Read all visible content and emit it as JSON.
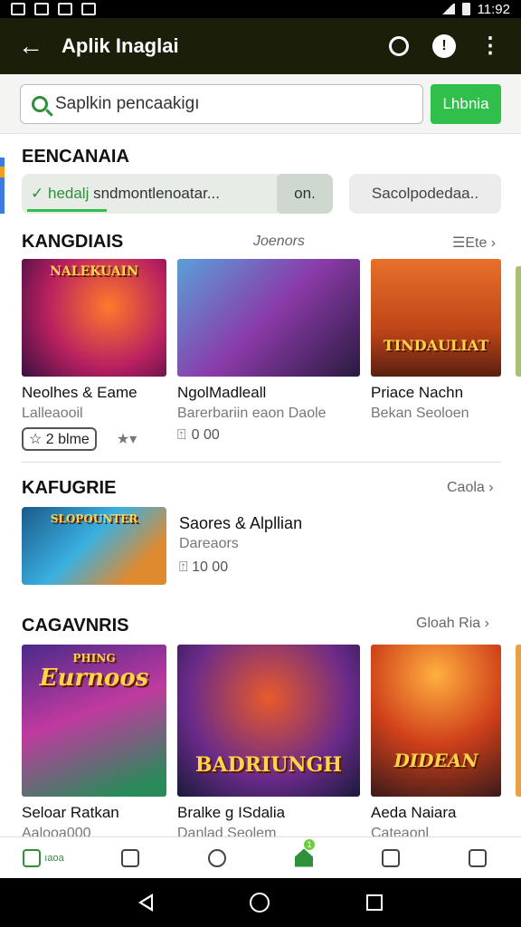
{
  "statusbar": {
    "time": "11:92"
  },
  "appbar": {
    "back_icon": "←",
    "title": "Aplik Ɩnaglai",
    "badge_glyph": "!"
  },
  "search": {
    "placeholder": "Saplkin pencaakigı",
    "button_label": "Lhbnia"
  },
  "section1": {
    "title": "EENCANAIA",
    "filter_prefix": "hedalj",
    "filter_text": "sndmontlenoatar...",
    "filter_on": "on.",
    "filter_right": "Sacolpodedaa.."
  },
  "section2": {
    "title": "KANGDIAIS",
    "middle_link": "Joenors",
    "right_link": "Ete",
    "cards": [
      {
        "name": "Neolhes & Eame",
        "sub": "Lalleaooil",
        "pill": "2  blme",
        "thumb_text": "NALEKUAIN"
      },
      {
        "name": "NgolMadleall",
        "sub": "Barerbariin eaon Daole",
        "meta": "0 00"
      },
      {
        "name": "Priace Nachn",
        "sub": "Bekan Seoloen",
        "thumb_text": "TINDAULIAT"
      }
    ]
  },
  "section3": {
    "title": "KAFUGRIE",
    "link": "Caola",
    "item": {
      "name": "Saores & Alpllian",
      "sub": "Dareaors",
      "meta": "10 00",
      "thumb_text": "SLOPOUNTER"
    }
  },
  "section4": {
    "title": "CAGAVNRIS",
    "link": "Gloah Ria",
    "cards": [
      {
        "name": "Seloar Ratkan",
        "sub": "Aalooa000",
        "thumb_text": "Eurnoos",
        "thumb_top": "PHING"
      },
      {
        "name": "Bralke g ISdalia",
        "sub": "Danlad Seolem",
        "thumb_text": "BADRIUNGH"
      },
      {
        "name": "Aeda Naiara",
        "sub": "Cateaonl",
        "thumb_text": "DIDEAN"
      }
    ]
  },
  "bottomnav": {
    "home_label": "ıaoa",
    "badge": "1"
  },
  "colors": {
    "accent": "#2fbf4a",
    "appbar": "#1b1f0a"
  }
}
